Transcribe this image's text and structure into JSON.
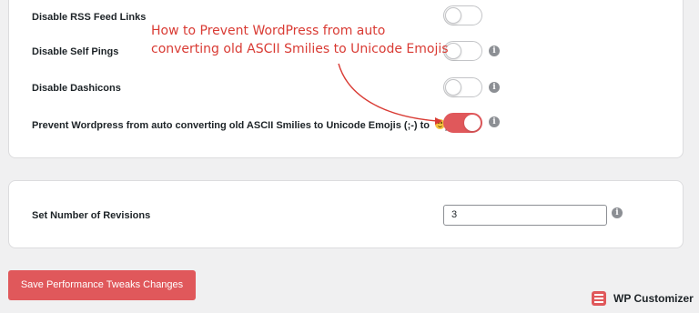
{
  "settings": {
    "rows": [
      {
        "label": "Disable RSS Feed Links",
        "state": "off",
        "info": false
      },
      {
        "label": "Disable Self Pings",
        "state": "off",
        "info": true
      },
      {
        "label": "Disable Dashicons",
        "state": "off",
        "info": true
      },
      {
        "label": "Prevent Wordpress from auto converting old ASCII Smilies to Unicode Emojis (;-) to",
        "state": "on",
        "info": true
      }
    ],
    "info_glyph": "i",
    "emoji_icon": "smiley-emoji-icon"
  },
  "revisions": {
    "label": "Set Number of Revisions",
    "value": "3"
  },
  "save_button": {
    "label": "Save Performance Tweaks Changes"
  },
  "annotation": {
    "line1": "How to Prevent WordPress from auto",
    "line2": "converting old ASCII Smilies to Unicode Emojis"
  },
  "brand": {
    "name": "WP Customizer"
  },
  "colors": {
    "accent": "#e0585b",
    "annotation": "#d93b34",
    "background": "#f0f0f1"
  }
}
